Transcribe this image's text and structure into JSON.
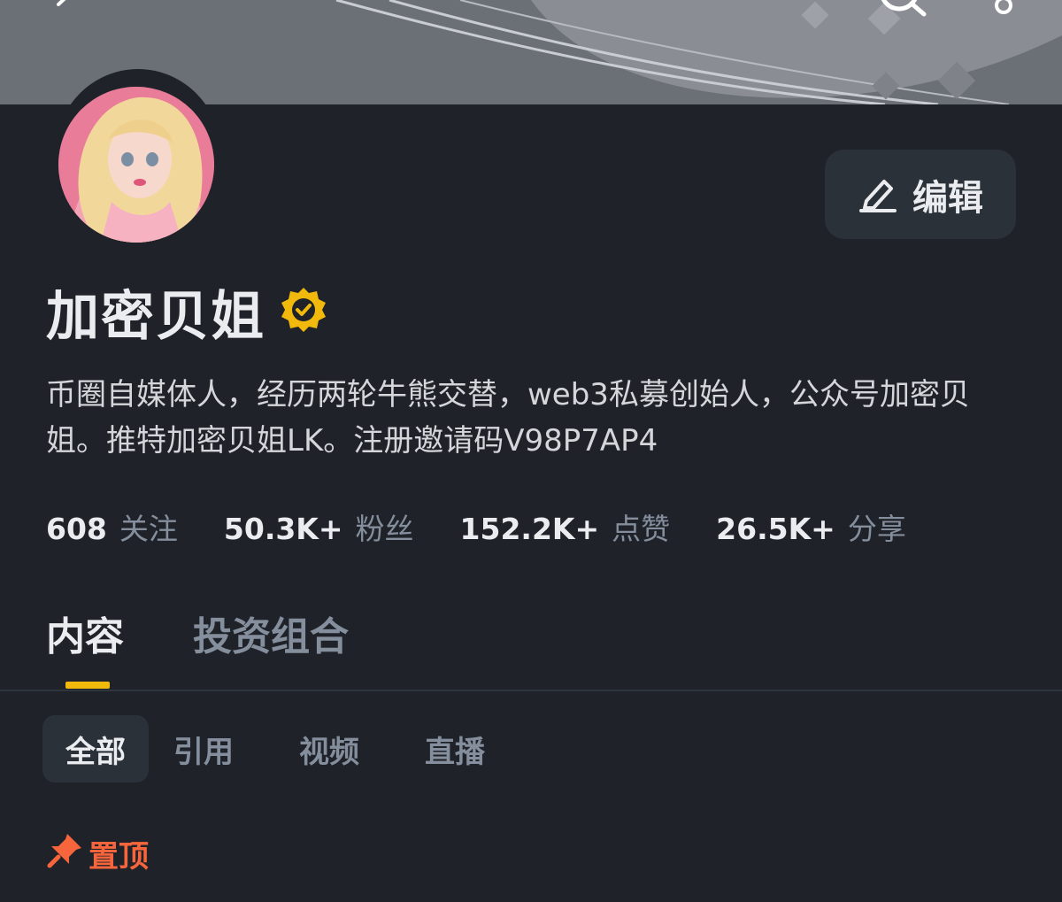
{
  "profile": {
    "name": "加密贝姐",
    "bio": "币圈自媒体人，经历两轮牛熊交替，web3私募创始人，公众号加密贝姐。推特加密贝姐LK。注册邀请码V98P7AP4",
    "edit_label": "编辑"
  },
  "stats": [
    {
      "value": "608",
      "label": "关注"
    },
    {
      "value": "50.3K+",
      "label": "粉丝"
    },
    {
      "value": "152.2K+",
      "label": "点赞"
    },
    {
      "value": "26.5K+",
      "label": "分享"
    }
  ],
  "tabs": [
    {
      "label": "内容",
      "active": true
    },
    {
      "label": "投资组合",
      "active": false
    }
  ],
  "subtabs": [
    {
      "label": "全部",
      "active": true
    },
    {
      "label": "引用",
      "active": false
    },
    {
      "label": "视频",
      "active": false
    },
    {
      "label": "直播",
      "active": false
    }
  ],
  "pinned_label": "置顶",
  "colors": {
    "background": "#1f2329",
    "accent": "#f0b90b",
    "pinned": "#f6653b",
    "muted_text": "#848e9c"
  },
  "icons": [
    "back-icon",
    "search-icon",
    "share-icon",
    "edit-pencil-icon",
    "verified-badge-icon",
    "pin-icon"
  ]
}
